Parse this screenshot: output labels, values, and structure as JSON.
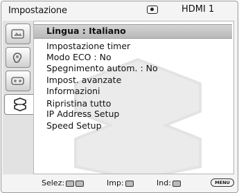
{
  "header": {
    "title": "Impostazione",
    "input_icon": "input-source-icon",
    "source": "HDMI 1"
  },
  "sidebar": {
    "tabs": [
      {
        "icon": "picture-icon"
      },
      {
        "icon": "audio-icon"
      },
      {
        "icon": "display-icon"
      },
      {
        "icon": "settings-icon",
        "active": true
      }
    ]
  },
  "menu": {
    "items": [
      "Lingua : Italiano",
      "Impostazione timer",
      "Modo ECO : No",
      "Spegnimento autom. : No",
      "Impost. avanzate",
      "Informazioni",
      "Ripristina tutto",
      "IP Address Setup",
      "Speed Setup"
    ]
  },
  "footer": {
    "select_label": "Selez:",
    "enter_label": "Imp:",
    "back_label": "Ind:",
    "menu_key": "MENU"
  }
}
